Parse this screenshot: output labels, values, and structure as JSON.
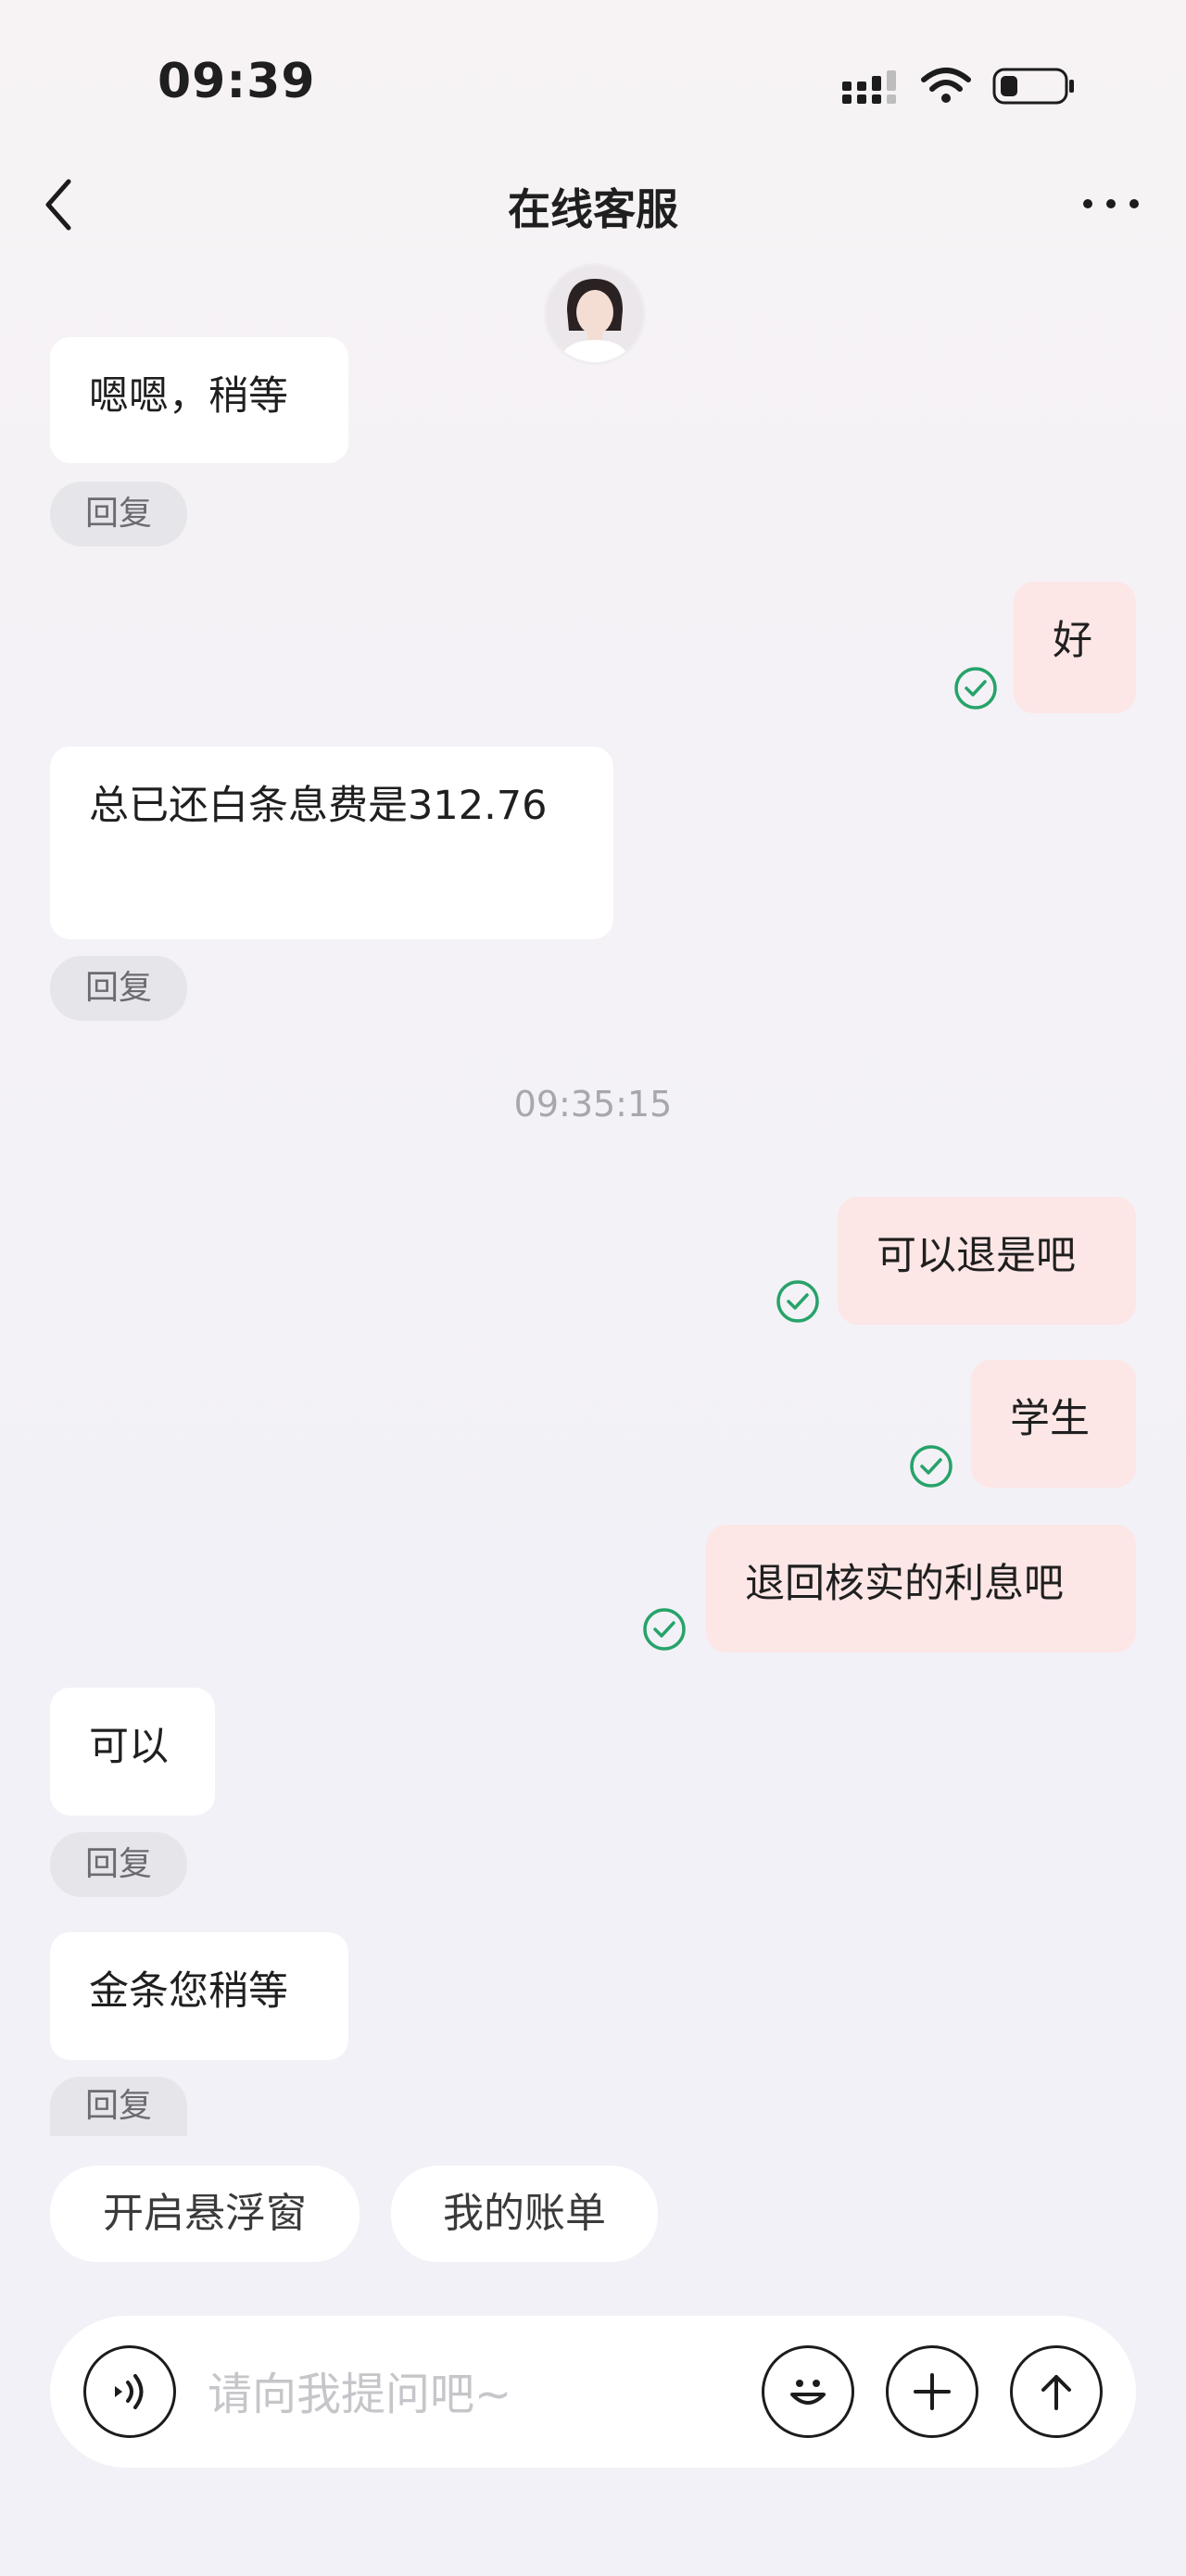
{
  "status_bar": {
    "time": "09:39"
  },
  "header": {
    "title": "在线客服"
  },
  "messages": {
    "m1": {
      "text": "嗯嗯，稍等"
    },
    "m2": {
      "text": "好"
    },
    "m3": {
      "text": "总已还白条息费是312.76"
    },
    "timestamp": "09:35:15",
    "m4": {
      "text": "可以退是吧"
    },
    "m5": {
      "text": "学生"
    },
    "m6": {
      "text": "退回核实的利息吧"
    },
    "m7": {
      "text": "可以"
    },
    "m8": {
      "text": "金条您稍等"
    },
    "reply_label": "回复"
  },
  "quick_actions": [
    {
      "label": "开启悬浮窗"
    },
    {
      "label": "我的账单"
    }
  ],
  "composer": {
    "placeholder": "请向我提问吧~",
    "icons": [
      "voice-icon",
      "emoji-icon",
      "plus-icon",
      "send-up-icon"
    ]
  },
  "colors": {
    "incoming_bubble": "#ffffff",
    "outgoing_bubble": "#fde6e6",
    "read_check": "#27a36a",
    "reply_pill": "#e6e6ea"
  }
}
